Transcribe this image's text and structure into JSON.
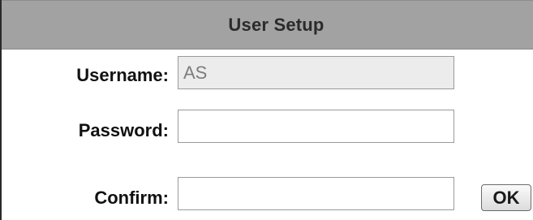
{
  "panel": {
    "title": "User Setup"
  },
  "form": {
    "username": {
      "label": "Username:",
      "value": "AS"
    },
    "password": {
      "label": "Password:",
      "value": ""
    },
    "confirm": {
      "label": "Confirm:",
      "value": ""
    },
    "ok_label": "OK"
  },
  "colors": {
    "header_bg": "#a2a2a2",
    "readonly_field_bg": "#ececec",
    "field_border": "#9a9a9a"
  }
}
